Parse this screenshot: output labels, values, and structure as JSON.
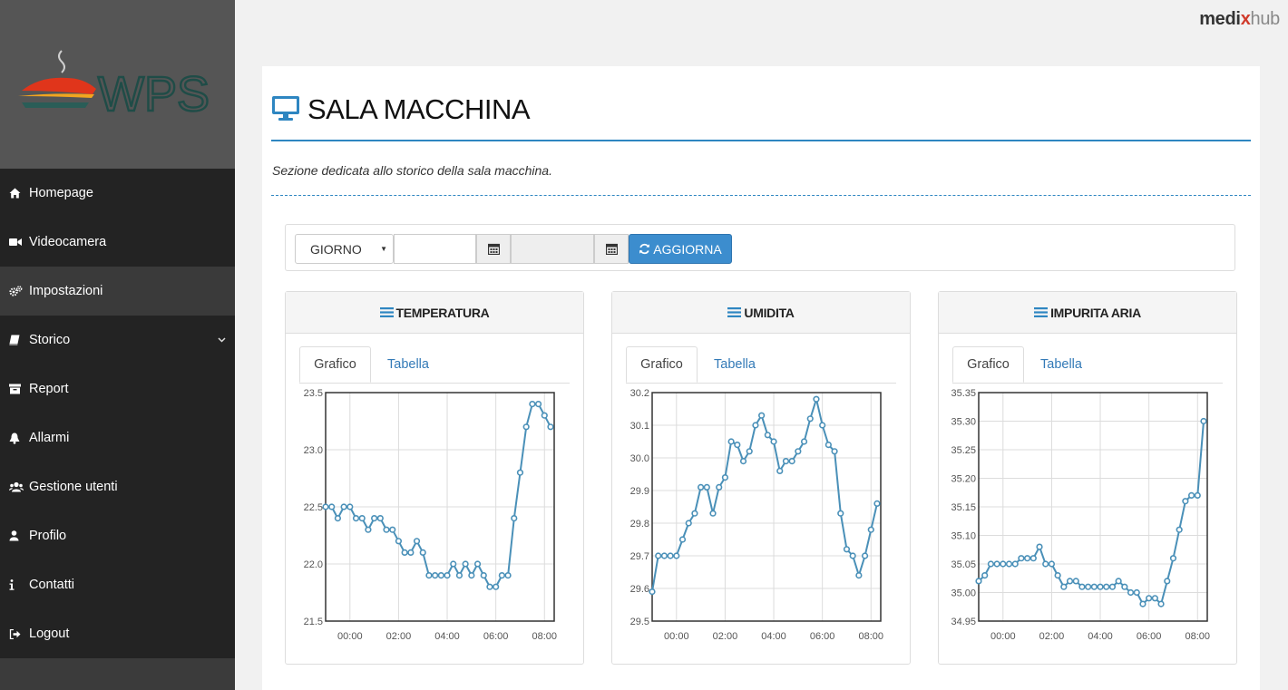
{
  "brand": {
    "part1": "medi",
    "part2": "x",
    "part3": "hub"
  },
  "sidebar": {
    "logo_text": "WPS",
    "items": [
      {
        "label": "Homepage",
        "icon": "home-icon"
      },
      {
        "label": "Videocamera",
        "icon": "video-camera-icon"
      },
      {
        "label": "Impostazioni",
        "icon": "cogs-icon",
        "active": true
      },
      {
        "label": "Storico",
        "icon": "book-icon",
        "has_submenu": true
      },
      {
        "label": "Report",
        "icon": "archive-icon"
      },
      {
        "label": "Allarmi",
        "icon": "bell-icon"
      },
      {
        "label": "Gestione utenti",
        "icon": "users-icon"
      },
      {
        "label": "Profilo",
        "icon": "user-icon"
      },
      {
        "label": "Contatti",
        "icon": "info-icon"
      },
      {
        "label": "Logout",
        "icon": "sign-out-icon"
      }
    ]
  },
  "page": {
    "title": "SALA MACCHINA",
    "subtitle": "Sezione dedicata allo storico della sala macchina.",
    "title_icon": "desktop-icon",
    "accent_color": "#2e86c1"
  },
  "filter": {
    "period_value": "GIORNO",
    "from_date": "",
    "to_date": "",
    "refresh_label": "AGGIORNA",
    "button_color": "#3c8dce"
  },
  "cards": [
    {
      "title": "TEMPERATURA",
      "tab_graph": "Grafico",
      "tab_table": "Tabella"
    },
    {
      "title": "UMIDITA",
      "tab_graph": "Grafico",
      "tab_table": "Tabella"
    },
    {
      "title": "IMPURITA ARIA",
      "tab_graph": "Grafico",
      "tab_table": "Tabella"
    }
  ],
  "chart_data": [
    {
      "type": "line",
      "title": "TEMPERATURA",
      "xlabel": "",
      "ylabel": "",
      "x_ticks": [
        "00:00",
        "02:00",
        "04:00",
        "06:00",
        "08:00"
      ],
      "y_ticks": [
        "21.5",
        "22.0",
        "22.5",
        "23.0",
        "23.5"
      ],
      "ylim": [
        21.5,
        23.5
      ],
      "xlim_hours": [
        -1,
        8.4
      ],
      "grid": true,
      "line_color": "#4a90b8",
      "series": [
        {
          "x_hours": [
            -1,
            -0.75,
            -0.5,
            -0.25,
            0,
            0.25,
            0.5,
            0.75,
            1,
            1.25,
            1.5,
            1.75,
            2,
            2.25,
            2.5,
            2.75,
            3,
            3.25,
            3.5,
            3.75,
            4,
            4.25,
            4.5,
            4.75,
            5,
            5.25,
            5.5,
            5.75,
            6,
            6.25,
            6.5,
            6.75,
            7,
            7.25,
            7.5,
            7.75,
            8,
            8.25
          ],
          "y": [
            22.5,
            22.5,
            22.4,
            22.5,
            22.5,
            22.4,
            22.4,
            22.3,
            22.4,
            22.4,
            22.3,
            22.3,
            22.2,
            22.1,
            22.1,
            22.2,
            22.1,
            21.9,
            21.9,
            21.9,
            21.9,
            22.0,
            21.9,
            22.0,
            21.9,
            22.0,
            21.9,
            21.8,
            21.8,
            21.9,
            21.9,
            22.4,
            22.8,
            23.2,
            23.4,
            23.4,
            23.3,
            23.2
          ]
        }
      ]
    },
    {
      "type": "line",
      "title": "UMIDITA",
      "xlabel": "",
      "ylabel": "",
      "x_ticks": [
        "00:00",
        "02:00",
        "04:00",
        "06:00",
        "08:00"
      ],
      "y_ticks": [
        "29.5",
        "29.6",
        "29.7",
        "29.8",
        "29.9",
        "30.0",
        "30.1",
        "30.2"
      ],
      "ylim": [
        29.5,
        30.2
      ],
      "xlim_hours": [
        -1,
        8.4
      ],
      "grid": true,
      "line_color": "#4a90b8",
      "series": [
        {
          "x_hours": [
            -1,
            -0.75,
            -0.5,
            -0.25,
            0,
            0.25,
            0.5,
            0.75,
            1,
            1.25,
            1.5,
            1.75,
            2,
            2.25,
            2.5,
            2.75,
            3,
            3.25,
            3.5,
            3.75,
            4,
            4.25,
            4.5,
            4.75,
            5,
            5.25,
            5.5,
            5.75,
            6,
            6.25,
            6.5,
            6.75,
            7,
            7.25,
            7.5,
            7.75,
            8,
            8.25
          ],
          "y": [
            29.59,
            29.7,
            29.7,
            29.7,
            29.7,
            29.75,
            29.8,
            29.83,
            29.91,
            29.91,
            29.83,
            29.91,
            29.94,
            30.05,
            30.04,
            29.99,
            30.02,
            30.1,
            30.13,
            30.07,
            30.05,
            29.96,
            29.99,
            29.99,
            30.02,
            30.05,
            30.12,
            30.18,
            30.1,
            30.04,
            30.02,
            29.83,
            29.72,
            29.7,
            29.64,
            29.7,
            29.78,
            29.86
          ]
        }
      ]
    },
    {
      "type": "line",
      "title": "IMPURITA ARIA",
      "xlabel": "",
      "ylabel": "",
      "x_ticks": [
        "00:00",
        "02:00",
        "04:00",
        "06:00",
        "08:00"
      ],
      "y_ticks": [
        "34.95",
        "35.00",
        "35.05",
        "35.10",
        "35.15",
        "35.20",
        "35.25",
        "35.30",
        "35.35"
      ],
      "ylim": [
        34.95,
        35.35
      ],
      "xlim_hours": [
        -1,
        8.4
      ],
      "grid": true,
      "line_color": "#4a90b8",
      "series": [
        {
          "x_hours": [
            -1,
            -0.75,
            -0.5,
            -0.25,
            0,
            0.25,
            0.5,
            0.75,
            1,
            1.25,
            1.5,
            1.75,
            2,
            2.25,
            2.5,
            2.75,
            3,
            3.25,
            3.5,
            3.75,
            4,
            4.25,
            4.5,
            4.75,
            5,
            5.25,
            5.5,
            5.75,
            6,
            6.25,
            6.5,
            6.75,
            7,
            7.25,
            7.5,
            7.75,
            8,
            8.25
          ],
          "y": [
            35.02,
            35.03,
            35.05,
            35.05,
            35.05,
            35.05,
            35.05,
            35.06,
            35.06,
            35.06,
            35.08,
            35.05,
            35.05,
            35.03,
            35.01,
            35.02,
            35.02,
            35.01,
            35.01,
            35.01,
            35.01,
            35.01,
            35.01,
            35.02,
            35.01,
            35.0,
            35.0,
            34.98,
            34.99,
            34.99,
            34.98,
            35.02,
            35.06,
            35.11,
            35.16,
            35.17,
            35.17,
            35.3
          ]
        }
      ]
    }
  ]
}
